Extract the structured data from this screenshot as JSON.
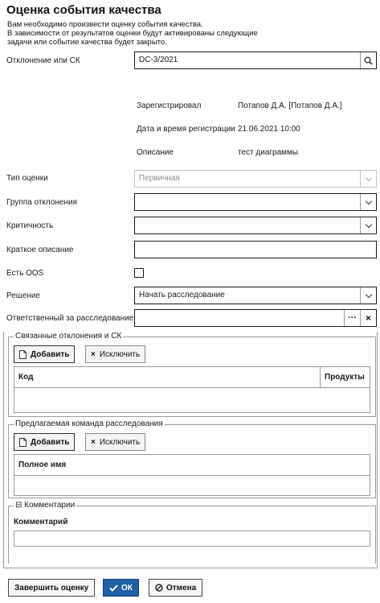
{
  "dialog": {
    "title": "Оценка события качества",
    "intro_lines": [
      "Вам необходимо произвести оценку события качества.",
      "В зависимости от результатов оценки будут активированы следующие",
      "задачи или событие качества будет закрыто."
    ]
  },
  "form": {
    "deviation": {
      "label": "Отклонение или СК",
      "value": "DC-3/2021"
    },
    "registered_by": {
      "label": "Зарегистрировал",
      "value": "Потапов Д.А. [Потапов Д.А.]"
    },
    "registered_at": {
      "label": "Дата и время регистрации",
      "value": "21.06.2021 10:00"
    },
    "description": {
      "label": "Описание",
      "value": "тест диаграммы"
    },
    "assessment_type": {
      "label": "Тип оценки",
      "value": "Первичная"
    },
    "deviation_group": {
      "label": "Группа отклонения",
      "value": ""
    },
    "criticality": {
      "label": "Критичность",
      "value": ""
    },
    "short_description": {
      "label": "Краткое описание",
      "value": ""
    },
    "has_oos": {
      "label": "Есть OOS",
      "checked": false
    },
    "decision": {
      "label": "Решение",
      "value": "Начать расследование"
    },
    "responsible": {
      "label": "Ответственный за расследование",
      "value": "",
      "more_label": "···",
      "clear_label": "×"
    }
  },
  "linked": {
    "legend": "Связанные отклонения и СК",
    "add_label": "Добавить",
    "remove_label": "Исключить",
    "columns": [
      "Код",
      "Продукты"
    ]
  },
  "team": {
    "legend": "Предлагаемая команда расследования",
    "add_label": "Добавить",
    "remove_label": "Исключить",
    "columns": [
      "Полное имя"
    ]
  },
  "comments": {
    "legend": "Комментарии",
    "collapse_glyph": "⊟",
    "field_label": "Комментарий",
    "value": ""
  },
  "footer": {
    "finish_label": "Завершить оценку",
    "ok_label": "ОК",
    "cancel_label": "Отмена"
  },
  "colors": {
    "primary": "#1f5fa8",
    "border": "#9a9a9a"
  },
  "icons": [
    "search-icon",
    "chevron-down-icon",
    "document-icon",
    "close-icon",
    "checkmark-icon",
    "cancel-icon"
  ]
}
